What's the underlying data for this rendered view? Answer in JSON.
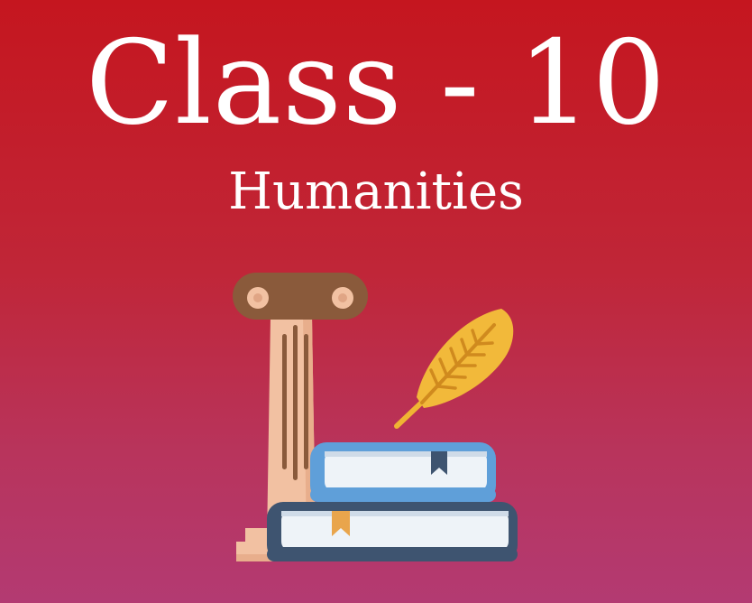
{
  "card": {
    "title": "Class - 10",
    "subtitle": "Humanities"
  },
  "illustration": {
    "icons": [
      "ionic-column-icon",
      "wheat-quill-icon",
      "book-stack-icon"
    ]
  },
  "colors": {
    "background_top": "#c5161f",
    "background_bottom": "#b33a72",
    "text": "#ffffff",
    "column_capital": "#8a5a3b",
    "column_shaft": "#f2c1a2",
    "wheat": "#f0b433",
    "book_top": "#5f9fd9",
    "book_bottom": "#3e5470",
    "bookmark_orange": "#e9a54c"
  }
}
